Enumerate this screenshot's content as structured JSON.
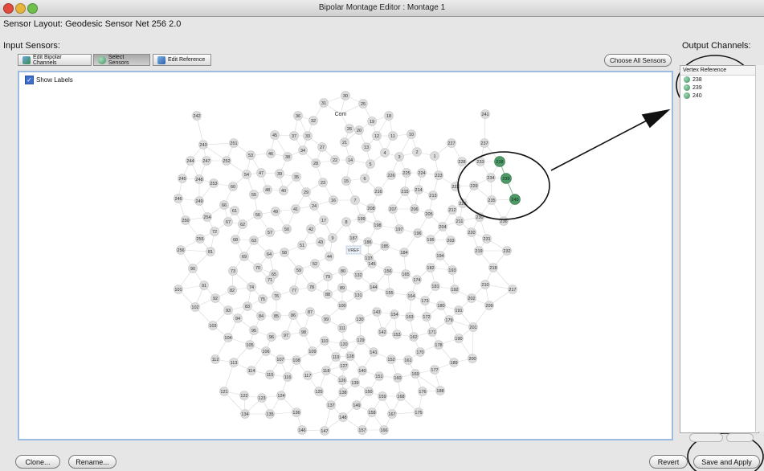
{
  "window": {
    "title": "Bipolar Montage Editor : Montage 1"
  },
  "layout": {
    "label": "Sensor Layout:",
    "value": "Geodesic Sensor Net 256 2.0"
  },
  "input_sensors": {
    "label": "Input Sensors:"
  },
  "toolbar": {
    "edit_bipolar": "Edit Bipolar Channels",
    "select_sensors": "Select Sensors",
    "edit_reference": "Edit Reference",
    "choose_all": "Choose All Sensors"
  },
  "show_labels": {
    "label": "Show Labels",
    "checked": true
  },
  "output": {
    "label": "Output Channels:",
    "header": "Vertex Reference",
    "items": [
      "238",
      "239",
      "240"
    ]
  },
  "bottom": {
    "clone": "Clone...",
    "rename": "Rename...",
    "revert": "Revert",
    "save_apply": "Save and Apply"
  },
  "sensors": [
    [
      "30",
      430,
      119
    ],
    [
      "31",
      403,
      128
    ],
    [
      "25",
      452,
      129
    ],
    [
      "36",
      371,
      144
    ],
    [
      "32",
      390,
      150
    ],
    [
      "Com",
      424,
      142
    ],
    [
      "19",
      463,
      151
    ],
    [
      "18",
      484,
      144
    ],
    [
      "242",
      245,
      144
    ],
    [
      "241",
      604,
      142
    ],
    [
      "26",
      435,
      160
    ],
    [
      "20",
      447,
      162
    ],
    [
      "45",
      342,
      168
    ],
    [
      "37",
      366,
      169
    ],
    [
      "33",
      383,
      169
    ],
    [
      "21",
      429,
      177
    ],
    [
      "12",
      469,
      169
    ],
    [
      "11",
      489,
      169
    ],
    [
      "10",
      512,
      167
    ],
    [
      "243",
      253,
      180
    ],
    [
      "251",
      291,
      178
    ],
    [
      "53",
      312,
      193
    ],
    [
      "46",
      337,
      191
    ],
    [
      "38",
      358,
      195
    ],
    [
      "34",
      377,
      187
    ],
    [
      "27",
      401,
      183
    ],
    [
      "13",
      456,
      183
    ],
    [
      "4",
      479,
      190
    ],
    [
      "3",
      497,
      195
    ],
    [
      "2",
      519,
      189
    ],
    [
      "1",
      541,
      194
    ],
    [
      "227",
      562,
      178
    ],
    [
      "237",
      603,
      178
    ],
    [
      "244",
      237,
      200
    ],
    [
      "247",
      257,
      200
    ],
    [
      "252",
      282,
      200
    ],
    [
      "28",
      393,
      203
    ],
    [
      "22",
      417,
      199
    ],
    [
      "14",
      436,
      199
    ],
    [
      "5",
      461,
      204
    ],
    [
      "228",
      575,
      201
    ],
    [
      "233",
      598,
      201
    ],
    [
      "238",
      622,
      201
    ],
    [
      "245",
      227,
      222
    ],
    [
      "248",
      248,
      223
    ],
    [
      "253",
      266,
      228
    ],
    [
      "54",
      307,
      217
    ],
    [
      "47",
      325,
      215
    ],
    [
      "39",
      348,
      216
    ],
    [
      "35",
      369,
      220
    ],
    [
      "23",
      402,
      227
    ],
    [
      "15",
      431,
      225
    ],
    [
      "6",
      454,
      222
    ],
    [
      "226",
      487,
      218
    ],
    [
      "225",
      506,
      215
    ],
    [
      "224",
      525,
      215
    ],
    [
      "223",
      546,
      218
    ],
    [
      "234",
      611,
      221
    ],
    [
      "239",
      630,
      222
    ],
    [
      "246",
      222,
      247
    ],
    [
      "249",
      248,
      250
    ],
    [
      "60",
      290,
      232
    ],
    [
      "55",
      316,
      242
    ],
    [
      "48",
      333,
      236
    ],
    [
      "40",
      353,
      237
    ],
    [
      "29",
      381,
      239
    ],
    [
      "16",
      415,
      249
    ],
    [
      "7",
      442,
      249
    ],
    [
      "216",
      471,
      238
    ],
    [
      "215",
      504,
      238
    ],
    [
      "214",
      521,
      236
    ],
    [
      "213",
      539,
      243
    ],
    [
      "222",
      567,
      232
    ],
    [
      "229",
      590,
      231
    ],
    [
      "235",
      612,
      249
    ],
    [
      "240",
      641,
      248
    ],
    [
      "66",
      279,
      255
    ],
    [
      "61",
      292,
      262
    ],
    [
      "56",
      321,
      267
    ],
    [
      "49",
      343,
      263
    ],
    [
      "41",
      368,
      260
    ],
    [
      "24",
      391,
      256
    ],
    [
      "208",
      462,
      259
    ],
    [
      "207",
      489,
      260
    ],
    [
      "206",
      516,
      260
    ],
    [
      "205",
      534,
      266
    ],
    [
      "221",
      576,
      253
    ],
    [
      "212",
      563,
      261
    ],
    [
      "250",
      231,
      274
    ],
    [
      "254",
      258,
      270
    ],
    [
      "67",
      284,
      276
    ],
    [
      "62",
      302,
      279
    ],
    [
      "17",
      403,
      274
    ],
    [
      "8",
      431,
      276
    ],
    [
      "199",
      450,
      272
    ],
    [
      "198",
      470,
      280
    ],
    [
      "197",
      497,
      285
    ],
    [
      "196",
      520,
      290
    ],
    [
      "204",
      551,
      282
    ],
    [
      "211",
      572,
      275
    ],
    [
      "230",
      597,
      270
    ],
    [
      "236",
      627,
      275
    ],
    [
      "72",
      267,
      288
    ],
    [
      "57",
      336,
      289
    ],
    [
      "50",
      357,
      285
    ],
    [
      "42",
      387,
      285
    ],
    [
      "9",
      414,
      296
    ],
    [
      "187",
      440,
      296
    ],
    [
      "186",
      458,
      301
    ],
    [
      "185",
      479,
      306
    ],
    [
      "195",
      536,
      298
    ],
    [
      "203",
      561,
      299
    ],
    [
      "220",
      587,
      289
    ],
    [
      "231",
      606,
      297
    ],
    [
      "255",
      249,
      297
    ],
    [
      "68",
      293,
      298
    ],
    [
      "63",
      316,
      299
    ],
    [
      "51",
      376,
      305
    ],
    [
      "43",
      399,
      301
    ],
    [
      "256",
      225,
      311
    ],
    [
      "81",
      262,
      313
    ],
    [
      "69",
      304,
      319
    ],
    [
      "64",
      335,
      316
    ],
    [
      "58",
      354,
      314
    ],
    [
      "44",
      410,
      319
    ],
    [
      "VREF",
      440,
      311
    ],
    [
      "133",
      459,
      321
    ],
    [
      "184",
      503,
      314
    ],
    [
      "194",
      548,
      318
    ],
    [
      "219",
      596,
      312
    ],
    [
      "232",
      631,
      312
    ],
    [
      "52",
      392,
      328
    ],
    [
      "145",
      463,
      328
    ],
    [
      "73",
      290,
      337
    ],
    [
      "70",
      321,
      333
    ],
    [
      "65",
      341,
      341
    ],
    [
      "59",
      372,
      336
    ],
    [
      "80",
      427,
      337
    ],
    [
      "132",
      446,
      342
    ],
    [
      "156",
      483,
      337
    ],
    [
      "165",
      505,
      341
    ],
    [
      "182",
      536,
      333
    ],
    [
      "193",
      563,
      336
    ],
    [
      "218",
      614,
      333
    ],
    [
      "90",
      240,
      334
    ],
    [
      "71",
      336,
      348
    ],
    [
      "79",
      408,
      344
    ],
    [
      "174",
      519,
      348
    ],
    [
      "91",
      254,
      355
    ],
    [
      "74",
      313,
      357
    ],
    [
      "78",
      388,
      357
    ],
    [
      "89",
      426,
      358
    ],
    [
      "144",
      465,
      357
    ],
    [
      "155",
      485,
      364
    ],
    [
      "164",
      512,
      368
    ],
    [
      "181",
      542,
      356
    ],
    [
      "192",
      566,
      360
    ],
    [
      "210",
      604,
      354
    ],
    [
      "217",
      638,
      360
    ],
    [
      "101",
      222,
      360
    ],
    [
      "82",
      289,
      361
    ],
    [
      "77",
      366,
      361
    ],
    [
      "75",
      327,
      372
    ],
    [
      "76",
      344,
      368
    ],
    [
      "88",
      408,
      366
    ],
    [
      "131",
      446,
      367
    ],
    [
      "173",
      529,
      374
    ],
    [
      "202",
      587,
      371
    ],
    [
      "92",
      268,
      371
    ],
    [
      "102",
      243,
      382
    ],
    [
      "83",
      308,
      381
    ],
    [
      "87",
      386,
      388
    ],
    [
      "100",
      426,
      380
    ],
    [
      "143",
      469,
      388
    ],
    [
      "154",
      491,
      391
    ],
    [
      "163",
      510,
      394
    ],
    [
      "172",
      531,
      394
    ],
    [
      "180",
      549,
      380
    ],
    [
      "191",
      571,
      386
    ],
    [
      "209",
      609,
      380
    ],
    [
      "93",
      284,
      386
    ],
    [
      "84",
      325,
      393
    ],
    [
      "85",
      344,
      393
    ],
    [
      "86",
      365,
      392
    ],
    [
      "94",
      296,
      396
    ],
    [
      "99",
      406,
      397
    ],
    [
      "130",
      448,
      397
    ],
    [
      "179",
      559,
      398
    ],
    [
      "103",
      265,
      405
    ],
    [
      "111",
      426,
      408
    ],
    [
      "201",
      589,
      407
    ],
    [
      "95",
      316,
      411
    ],
    [
      "96",
      338,
      419
    ],
    [
      "97",
      356,
      417
    ],
    [
      "98",
      378,
      413
    ],
    [
      "142",
      476,
      413
    ],
    [
      "153",
      494,
      416
    ],
    [
      "162",
      515,
      419
    ],
    [
      "171",
      538,
      413
    ],
    [
      "190",
      571,
      421
    ],
    [
      "104",
      284,
      420
    ],
    [
      "110",
      404,
      424
    ],
    [
      "120",
      428,
      428
    ],
    [
      "129",
      449,
      423
    ],
    [
      "105",
      311,
      429
    ],
    [
      "178",
      546,
      429
    ],
    [
      "106",
      331,
      437
    ],
    [
      "109",
      389,
      437
    ],
    [
      "119",
      418,
      444
    ],
    [
      "128",
      436,
      443
    ],
    [
      "141",
      465,
      438
    ],
    [
      "152",
      487,
      447
    ],
    [
      "161",
      508,
      448
    ],
    [
      "170",
      523,
      438
    ],
    [
      "189",
      565,
      451
    ],
    [
      "200",
      588,
      446
    ],
    [
      "107",
      349,
      447
    ],
    [
      "108",
      369,
      448
    ],
    [
      "112",
      268,
      447
    ],
    [
      "113",
      291,
      451
    ],
    [
      "118",
      406,
      461
    ],
    [
      "127",
      428,
      455
    ],
    [
      "140",
      451,
      461
    ],
    [
      "114",
      313,
      461
    ],
    [
      "115",
      336,
      466
    ],
    [
      "116",
      358,
      469
    ],
    [
      "117",
      383,
      467
    ],
    [
      "126",
      426,
      473
    ],
    [
      "139",
      442,
      476
    ],
    [
      "151",
      472,
      468
    ],
    [
      "160",
      495,
      470
    ],
    [
      "169",
      517,
      465
    ],
    [
      "177",
      541,
      460
    ],
    [
      "125",
      397,
      487
    ],
    [
      "138",
      427,
      488
    ],
    [
      "150",
      459,
      487
    ],
    [
      "121",
      279,
      487
    ],
    [
      "122",
      304,
      492
    ],
    [
      "123",
      326,
      495
    ],
    [
      "124",
      350,
      492
    ],
    [
      "137",
      412,
      504
    ],
    [
      "149",
      444,
      504
    ],
    [
      "159",
      476,
      493
    ],
    [
      "168",
      499,
      493
    ],
    [
      "176",
      526,
      487
    ],
    [
      "188",
      548,
      486
    ],
    [
      "134",
      305,
      515
    ],
    [
      "135",
      336,
      515
    ],
    [
      "136",
      369,
      513
    ],
    [
      "148",
      427,
      519
    ],
    [
      "158",
      463,
      513
    ],
    [
      "167",
      488,
      515
    ],
    [
      "175",
      521,
      513
    ],
    [
      "146",
      376,
      535
    ],
    [
      "147",
      404,
      536
    ],
    [
      "157",
      451,
      535
    ],
    [
      "166",
      478,
      535
    ]
  ]
}
